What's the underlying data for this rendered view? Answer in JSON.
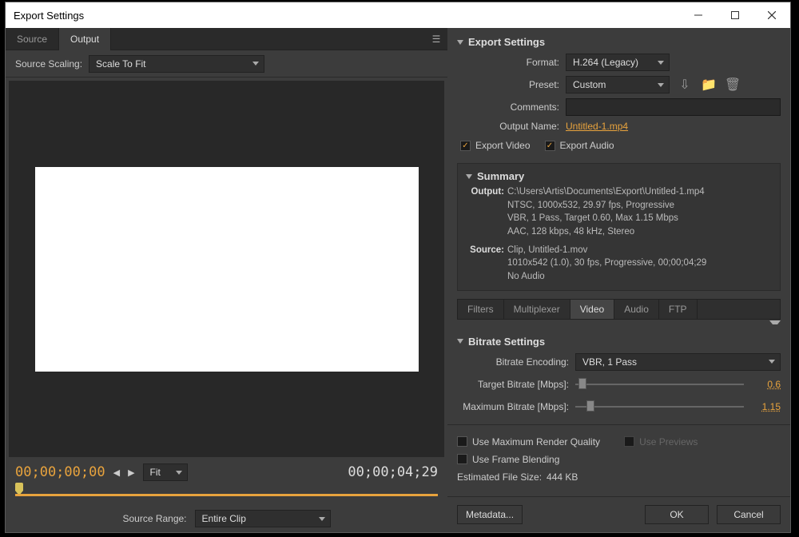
{
  "window": {
    "title": "Export Settings"
  },
  "leftTabs": {
    "source": "Source",
    "output": "Output"
  },
  "sourceScaling": {
    "label": "Source Scaling:",
    "value": "Scale To Fit"
  },
  "timeline": {
    "current": "00;00;00;00",
    "duration": "00;00;04;29",
    "fitLabel": "Fit"
  },
  "sourceRange": {
    "label": "Source Range:",
    "value": "Entire Clip"
  },
  "export": {
    "heading": "Export Settings",
    "formatLabel": "Format:",
    "formatValue": "H.264 (Legacy)",
    "presetLabel": "Preset:",
    "presetValue": "Custom",
    "commentsLabel": "Comments:",
    "outputNameLabel": "Output Name:",
    "outputNameValue": "Untitled-1.mp4",
    "exportVideo": "Export Video",
    "exportAudio": "Export Audio"
  },
  "summary": {
    "heading": "Summary",
    "outputKey": "Output:",
    "output1": "C:\\Users\\Artis\\Documents\\Export\\Untitled-1.mp4",
    "output2": "NTSC, 1000x532, 29.97 fps, Progressive",
    "output3": "VBR, 1 Pass, Target 0.60, Max 1.15 Mbps",
    "output4": "AAC, 128 kbps, 48 kHz, Stereo",
    "sourceKey": "Source:",
    "source1": "Clip, Untitled-1.mov",
    "source2": "1010x542 (1.0), 30 fps, Progressive, 00;00;04;29",
    "source3": "No Audio"
  },
  "settingsTabs": {
    "filters": "Filters",
    "multiplexer": "Multiplexer",
    "video": "Video",
    "audio": "Audio",
    "ftp": "FTP"
  },
  "bitrate": {
    "heading": "Bitrate Settings",
    "encodingLabel": "Bitrate Encoding:",
    "encodingValue": "VBR, 1 Pass",
    "targetLabel": "Target Bitrate [Mbps]:",
    "targetValue": "0.6",
    "maxLabel": "Maximum Bitrate [Mbps]:",
    "maxValue": "1.15"
  },
  "options": {
    "maxRender": "Use Maximum Render Quality",
    "usePreviews": "Use Previews",
    "frameBlend": "Use Frame Blending",
    "estLabel": "Estimated File Size:",
    "estValue": "444 KB"
  },
  "buttons": {
    "metadata": "Metadata...",
    "ok": "OK",
    "cancel": "Cancel"
  }
}
